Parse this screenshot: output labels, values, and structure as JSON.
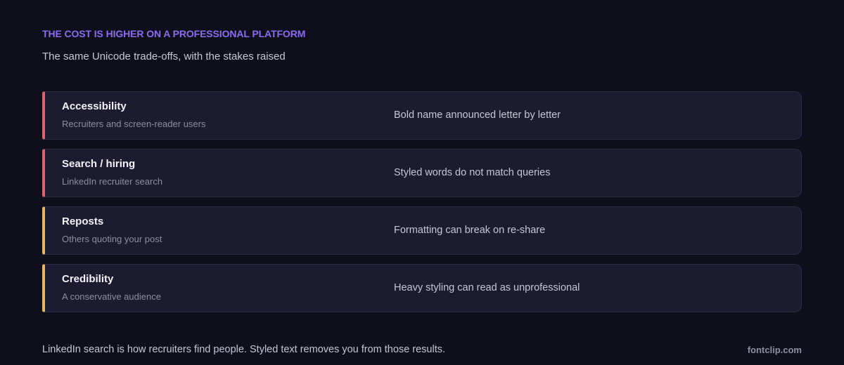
{
  "header": {
    "eyebrow": "THE COST IS HIGHER ON A PROFESSIONAL PLATFORM",
    "subtitle": "The same Unicode trade-offs, with the stakes raised"
  },
  "rows": [
    {
      "title": "Accessibility",
      "subtitle": "Recruiters and screen-reader users",
      "effect": "Bold name announced letter by letter",
      "accent": "#e0606e"
    },
    {
      "title": "Search / hiring",
      "subtitle": "LinkedIn recruiter search",
      "effect": "Styled words do not match queries",
      "accent": "#e0606e"
    },
    {
      "title": "Reposts",
      "subtitle": "Others quoting your post",
      "effect": "Formatting can break on re-share",
      "accent": "#e9b45c"
    },
    {
      "title": "Credibility",
      "subtitle": "A conservative audience",
      "effect": "Heavy styling can read as unprofessional",
      "accent": "#e9b45c"
    }
  ],
  "footer": {
    "text": "LinkedIn search is how recruiters find people. Styled text removes you from those results.",
    "brand": "fontclip.com"
  },
  "colors": {
    "background": "#0f0f1c",
    "eyebrow": "#8b6cf0",
    "row_background": "#1c1c30",
    "high_severity": "#e0606e",
    "medium_severity": "#e9b45c"
  }
}
